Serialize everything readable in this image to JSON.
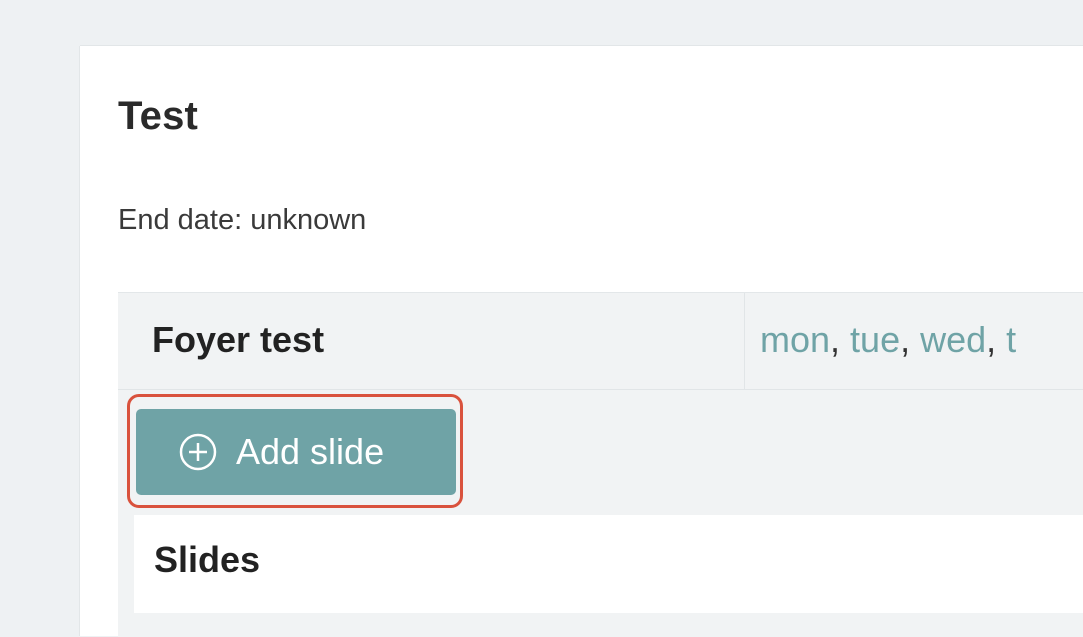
{
  "card": {
    "title": "Test",
    "end_date": "End date: unknown"
  },
  "schedule": {
    "name": "Foyer test",
    "days": [
      "mon",
      "tue",
      "wed",
      "t"
    ],
    "separator": ", ",
    "add_slide_label": "Add slide",
    "add_slide_icon": "plus-circle-icon",
    "slides_label": "Slides"
  },
  "colors": {
    "accent": "#6fa3a6",
    "highlight": "#d9523d",
    "background": "#eef1f3"
  }
}
